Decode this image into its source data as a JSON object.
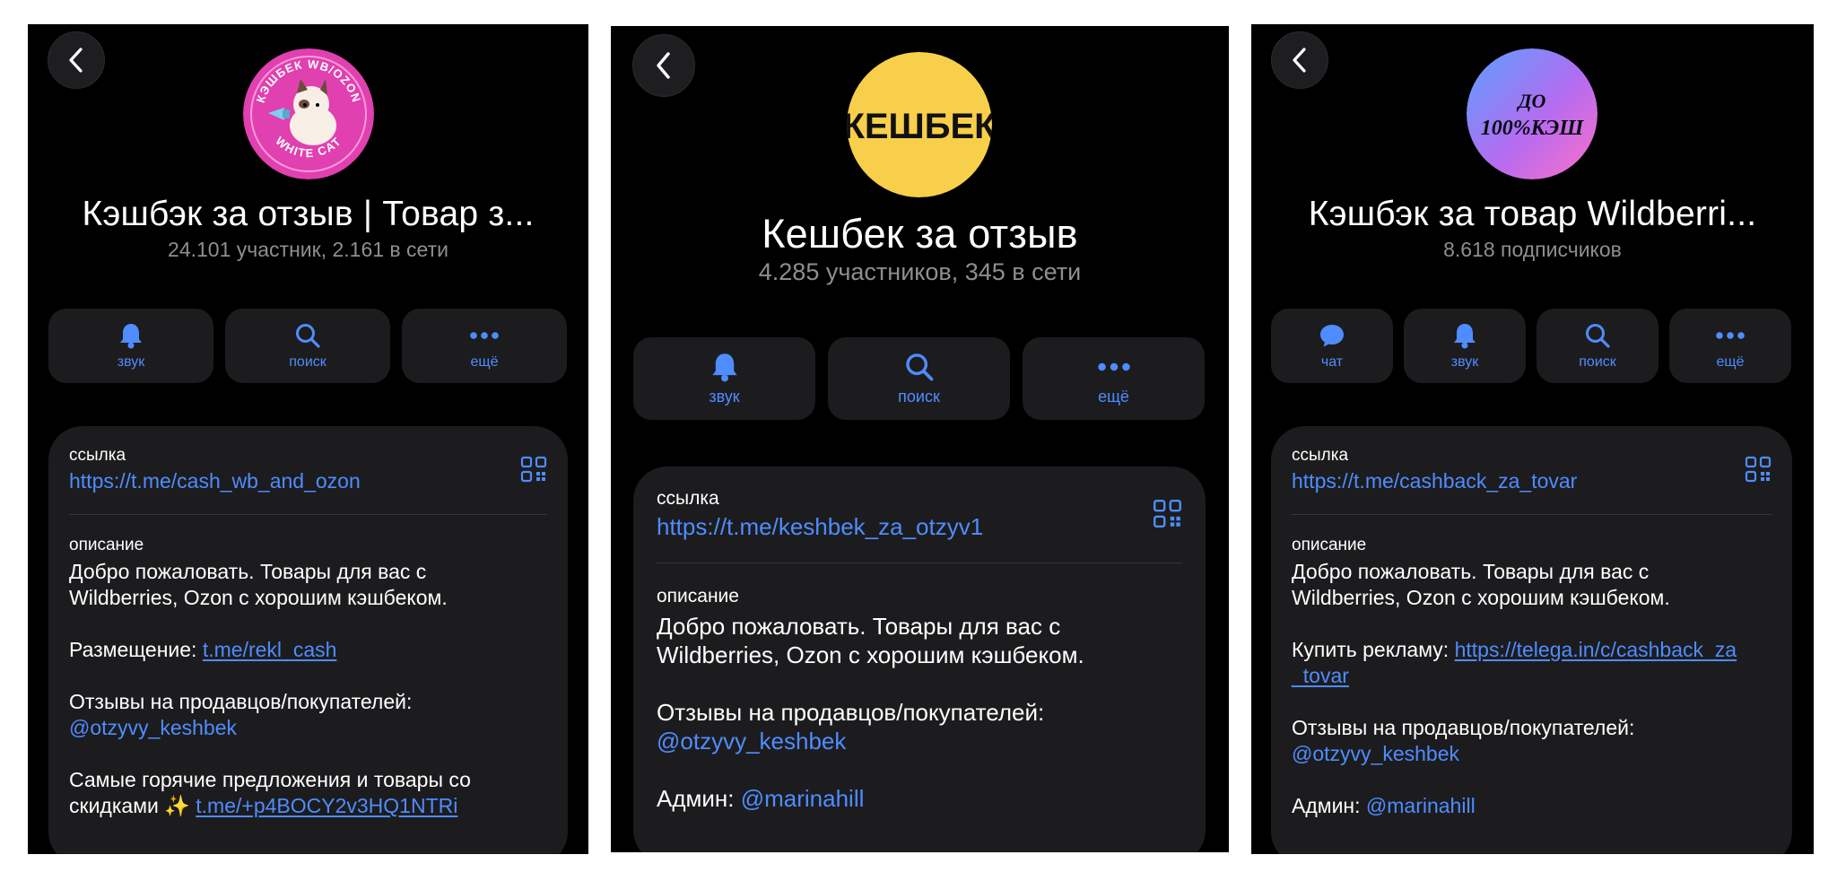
{
  "panels": [
    {
      "title": "Кэшбэк за отзыв | Товар з...",
      "subtitle": "24.101 участник, 2.161 в сети",
      "avatar": {
        "text_top": "КЭШБЕК WB/OZON",
        "text_bottom": "WHITE CAT",
        "bg": "#e040b0"
      },
      "actions": [
        {
          "label": "звук",
          "icon": "bell-icon"
        },
        {
          "label": "поиск",
          "icon": "search-icon"
        },
        {
          "label": "ещё",
          "icon": "more-icon"
        }
      ],
      "link_label": "ссылка",
      "link": "https://t.me/cash_wb_and_ozon",
      "description_label": "описание",
      "description": {
        "intro": "Добро пожаловать. Товары для вас с Wildberries, Ozon с хорошим кэшбеком.",
        "placement_label": "Размещение: ",
        "placement_link": "t.me/rekl_cash",
        "reviews_label": "Отзывы на продавцов/покупателей:",
        "reviews_handle": "@otzyvy_keshbek",
        "hot_text": "Самые горячие предложения и товары со скидками ✨ ",
        "hot_link": "t.me/+p4BOCY2v3HQ1NTRi"
      }
    },
    {
      "title": "Кешбек за отзыв",
      "subtitle": "4.285 участников, 345 в сети",
      "avatar": {
        "text": "КЕШБЕК",
        "bg": "#f7cf4a"
      },
      "actions": [
        {
          "label": "звук",
          "icon": "bell-icon"
        },
        {
          "label": "поиск",
          "icon": "search-icon"
        },
        {
          "label": "ещё",
          "icon": "more-icon"
        }
      ],
      "link_label": "ссылка",
      "link": "https://t.me/keshbek_za_otzyv1",
      "description_label": "описание",
      "description": {
        "intro": "Добро пожаловать. Товары для вас с Wildberries, Ozon с хорошим кэшбеком.",
        "reviews_label": "Отзывы на продавцов/покупателей:",
        "reviews_handle": "@otzyvy_keshbek",
        "admin_label": "Админ: ",
        "admin_handle": "@marinahill"
      }
    },
    {
      "title": "Кэшбэк за товар Wildberri...",
      "subtitle": "8.618 подписчиков",
      "avatar": {
        "text_top": "ДО",
        "text_bottom": "100%КЭШ",
        "bg": "#9b6cf0"
      },
      "actions": [
        {
          "label": "чат",
          "icon": "chat-icon"
        },
        {
          "label": "звук",
          "icon": "bell-icon"
        },
        {
          "label": "поиск",
          "icon": "search-icon"
        },
        {
          "label": "ещё",
          "icon": "more-icon"
        }
      ],
      "link_label": "ссылка",
      "link": "https://t.me/cashback_za_tovar",
      "description_label": "описание",
      "description": {
        "intro": "Добро пожаловать. Товары для вас с Wildberries, Ozon с хорошим кэшбеком.",
        "ads_label": "Купить рекламу: ",
        "ads_link": "https://telega.in/c/cashback_za_tovar",
        "reviews_label": "Отзывы на продавцов/покупателей:",
        "reviews_handle": "@otzyvy_keshbek",
        "admin_label": "Админ: ",
        "admin_handle": "@marinahill"
      }
    }
  ],
  "colors": {
    "accent": "#4f8cff",
    "panel_bg": "#000000",
    "card_bg": "#1c1c1e",
    "secondary_text": "#8e8e93"
  }
}
